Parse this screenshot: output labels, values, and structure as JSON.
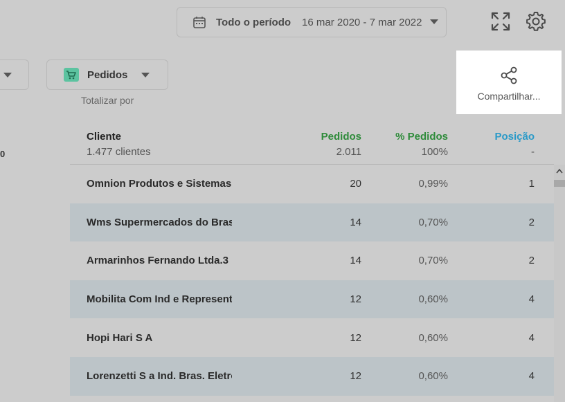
{
  "toolbar": {
    "period_label": "Todo o período",
    "date_range": "16 mar 2020 - 7 mar 2022"
  },
  "metric_select": {
    "label": "Pedidos"
  },
  "totalizar_label": "Totalizar por",
  "share": {
    "label": "Compartilhar..."
  },
  "left_partial": "0",
  "table": {
    "columns": {
      "cliente": "Cliente",
      "pedidos": "Pedidos",
      "pct_pedidos": "% Pedidos",
      "posicao": "Posição"
    },
    "summary": {
      "cliente": "1.477 clientes",
      "pedidos": "2.011",
      "pct_pedidos": "100%",
      "posicao": "-"
    },
    "rows": [
      {
        "cliente": "Omnion Produtos e Sistemas d",
        "pedidos": "20",
        "pct": "0,99%",
        "pos": "1"
      },
      {
        "cliente": "Wms Supermercados do Brasil",
        "pedidos": "14",
        "pct": "0,70%",
        "pos": "2"
      },
      {
        "cliente": "Armarinhos Fernando Ltda.3",
        "pedidos": "14",
        "pct": "0,70%",
        "pos": "2"
      },
      {
        "cliente": "Mobilita Com Ind e Representa",
        "pedidos": "12",
        "pct": "0,60%",
        "pos": "4"
      },
      {
        "cliente": "Hopi Hari S A",
        "pedidos": "12",
        "pct": "0,60%",
        "pos": "4"
      },
      {
        "cliente": "Lorenzetti S a Ind. Bras. Eletron",
        "pedidos": "12",
        "pct": "0,60%",
        "pos": "4"
      }
    ]
  },
  "colors": {
    "pedidos_header": "#2e8b3a",
    "posicao_header": "#2a9ac8",
    "row_alt": "#bcc4c8",
    "cart_icon_bg": "#5cc3a0"
  },
  "icons": [
    "calendar-icon",
    "chevron-down-icon",
    "fullscreen-icon",
    "gear-icon",
    "cart-icon",
    "share-icon",
    "scroll-up-icon"
  ]
}
